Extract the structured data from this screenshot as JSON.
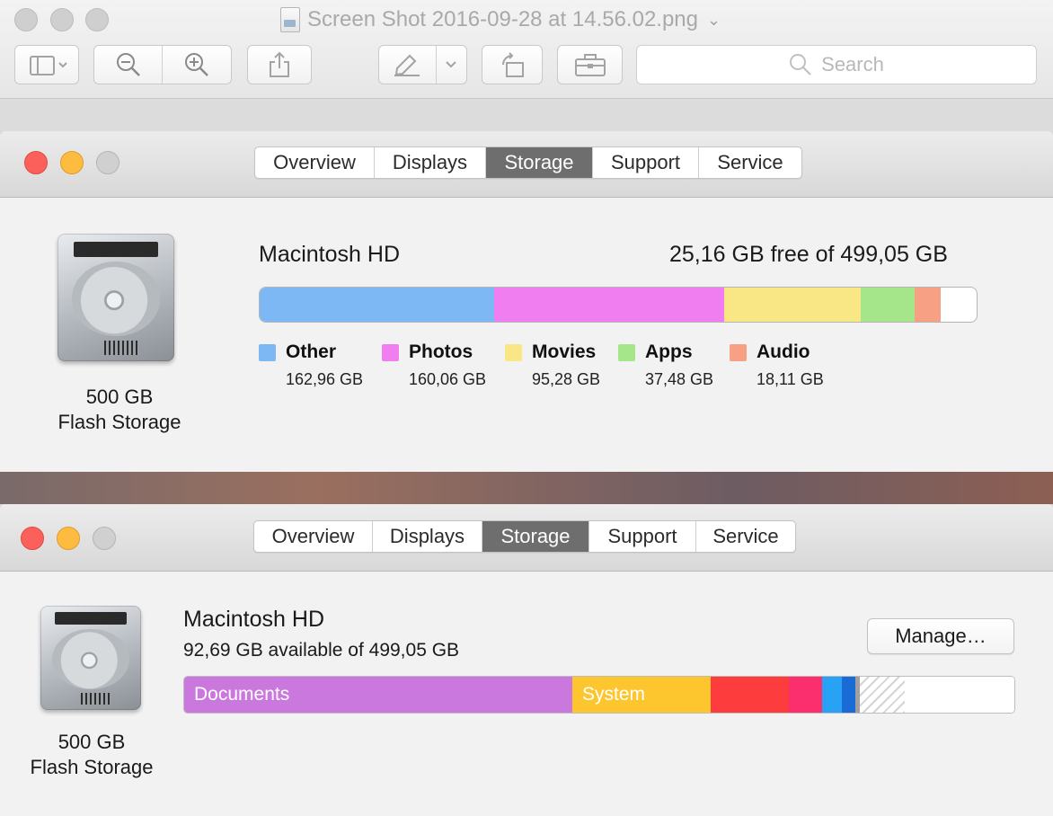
{
  "preview": {
    "title": "Screen Shot 2016-09-28 at 14.56.02.png",
    "search_placeholder": "Search",
    "toolbar_icons": [
      "sidebar-icon",
      "zoom-out-icon",
      "zoom-in-icon",
      "share-icon",
      "markup-pen-icon",
      "rotate-icon",
      "toolbox-icon"
    ]
  },
  "window1": {
    "tabs": [
      "Overview",
      "Displays",
      "Storage",
      "Support",
      "Service"
    ],
    "active_tab": "Storage",
    "disk": {
      "capacity": "500 GB",
      "type": "Flash Storage"
    },
    "volume": {
      "name": "Macintosh HD",
      "free": "25,16 GB free of 499,05 GB"
    },
    "categories": [
      {
        "name": "Other",
        "size": "162,96 GB",
        "color": "#7db8f5",
        "gb": 162.96
      },
      {
        "name": "Photos",
        "size": "160,06 GB",
        "color": "#f07ef0",
        "gb": 160.06
      },
      {
        "name": "Movies",
        "size": "95,28 GB",
        "color": "#f8e784",
        "gb": 95.28
      },
      {
        "name": "Apps",
        "size": "37,48 GB",
        "color": "#a5e68a",
        "gb": 37.48
      },
      {
        "name": "Audio",
        "size": "18,11 GB",
        "color": "#f7a084",
        "gb": 18.11
      }
    ],
    "total_gb": 499.05,
    "free_gb": 25.16
  },
  "window2": {
    "tabs": [
      "Overview",
      "Displays",
      "Storage",
      "Support",
      "Service"
    ],
    "active_tab": "Storage",
    "disk": {
      "capacity": "500 GB",
      "type": "Flash Storage"
    },
    "volume": {
      "name": "Macintosh HD",
      "available": "92,69 GB available of 499,05 GB"
    },
    "manage_label": "Manage…",
    "bar_segments": [
      {
        "label": "Documents",
        "color": "#ca78dd"
      },
      {
        "label": "System",
        "color": "#fdc62f"
      },
      {
        "label": "",
        "color": "#fd3c3d"
      },
      {
        "label": "",
        "color": "#fc2f6e"
      },
      {
        "label": "",
        "color": "#27a2f4"
      },
      {
        "label": "",
        "color": "#1b6bd6"
      },
      {
        "label": "",
        "color": "#a0a0a0"
      },
      {
        "label": "",
        "color": "purgeable"
      },
      {
        "label": "",
        "color": "#ffffff"
      }
    ]
  }
}
